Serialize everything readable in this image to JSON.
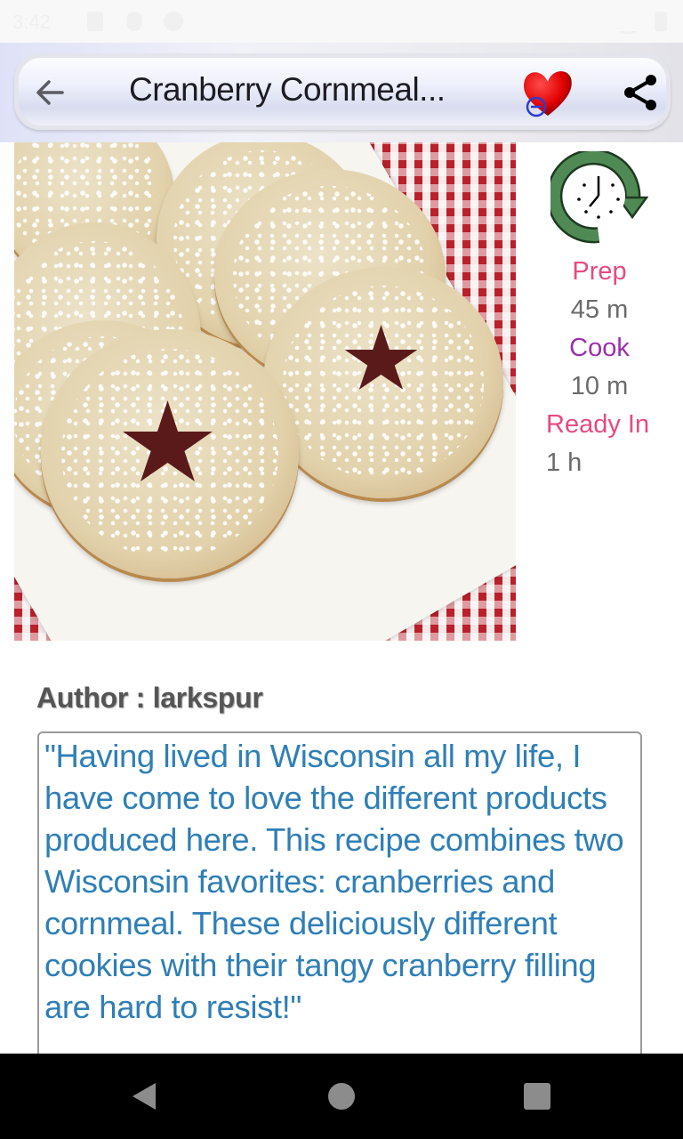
{
  "status_bar": {
    "time": "3:42",
    "icons": [
      "sim-card-icon",
      "notification-icon",
      "at-sign-icon",
      "wifi-icon",
      "battery-icon"
    ]
  },
  "app_bar": {
    "back_icon": "arrow-left-icon",
    "title": "Cranberry Cornmeal...",
    "favorite_icon": "heart-minus-icon",
    "share_icon": "share-icon"
  },
  "recipe": {
    "image_alt": "Cranberry cornmeal sandwich cookies with star cutouts dusted with powdered sugar on a white plate",
    "times": {
      "icon": "clock-refresh-icon",
      "prep_label": "Prep",
      "prep_value": "45 m",
      "cook_label": "Cook",
      "cook_value": "10 m",
      "ready_label": "Ready In",
      "ready_value": "1 h"
    },
    "author_line": "Author : larkspur",
    "description": "\"Having lived in Wisconsin all my life, I have come to love the different products produced here. This recipe combines two Wisconsin favorites: cranberries and cornmeal. These deliciously different cookies with their tangy cranberry filling are hard to resist!\""
  },
  "colors": {
    "prep": "#e84a7f",
    "cook": "#9b2fae",
    "ready": "#e84a7f",
    "time_value": "#6b6b6b",
    "description": "#2f7fb6",
    "author": "#555555"
  },
  "nav_bar": {
    "back": "nav-back-icon",
    "home": "nav-home-icon",
    "recents": "nav-recents-icon"
  }
}
